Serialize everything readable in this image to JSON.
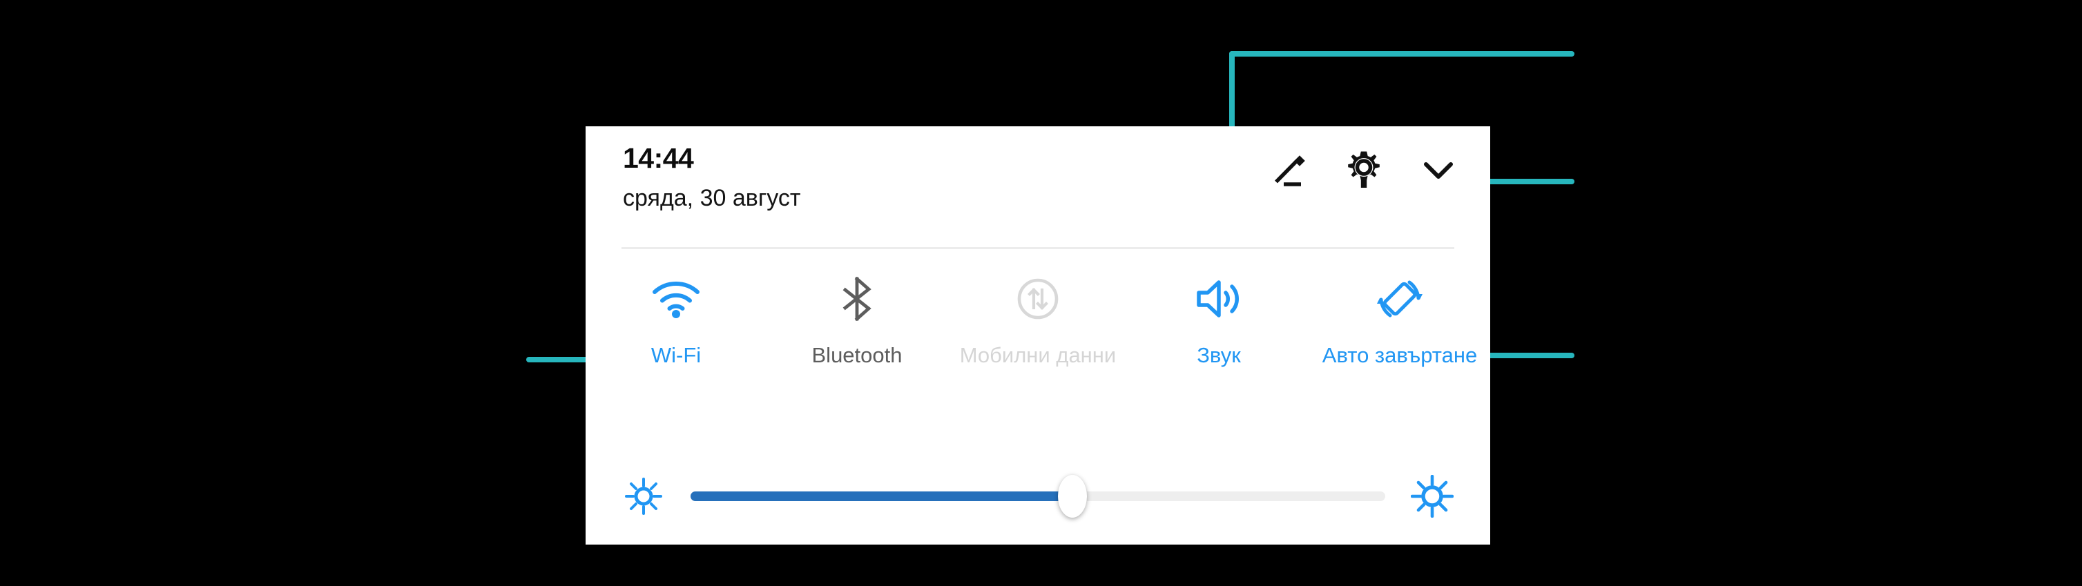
{
  "panel": {
    "header": {
      "time": "14:44",
      "date": "сряда, 30 август",
      "actions": [
        {
          "name": "edit-icon",
          "label": "Edit"
        },
        {
          "name": "gear-icon",
          "label": "Settings"
        },
        {
          "name": "chevron-down-icon",
          "label": "Collapse"
        }
      ]
    },
    "tiles": [
      {
        "id": "wifi",
        "label": "Wi-Fi",
        "icon": "wifi-icon",
        "state": "on"
      },
      {
        "id": "bluetooth",
        "label": "Bluetooth",
        "icon": "bluetooth-icon",
        "state": "off"
      },
      {
        "id": "mobile-data",
        "label": "Мобилни данни",
        "icon": "mobile-data-icon",
        "state": "disabled"
      },
      {
        "id": "sound",
        "label": "Звук",
        "icon": "volume-icon",
        "state": "on"
      },
      {
        "id": "auto-rotate",
        "label": "Авто завъртане",
        "icon": "auto-rotate-icon",
        "state": "on"
      }
    ],
    "brightness": {
      "low_icon": "brightness-low-icon",
      "high_icon": "brightness-high-icon",
      "value_percent": 55
    }
  },
  "annotations": {
    "accent_color": "#27b6bd",
    "callouts": [
      {
        "id": "edit-callout",
        "target": "edit-icon"
      },
      {
        "id": "collapse-callout",
        "target": "chevron-down-icon"
      },
      {
        "id": "wifi-callout",
        "target": "wifi-tile"
      },
      {
        "id": "auto-rotate-callout",
        "target": "auto-rotate-tile"
      }
    ]
  },
  "colors": {
    "accent_teal": "#27b6bd",
    "active_blue": "#2196f3",
    "slider_blue": "#2670bb",
    "inactive_gray": "#5d5d5d",
    "disabled_gray": "#d5d5d5",
    "panel_bg": "#ffffff",
    "page_bg": "#000000"
  }
}
